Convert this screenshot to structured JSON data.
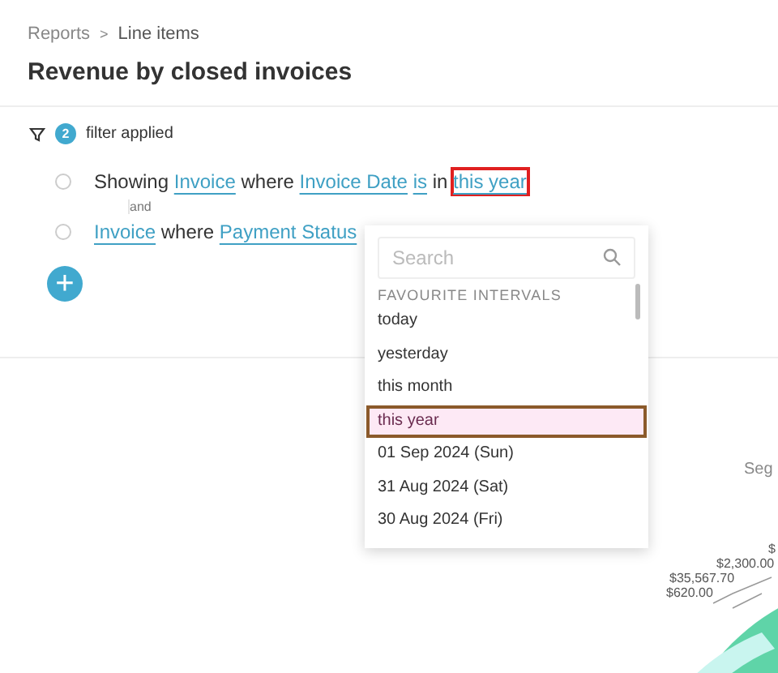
{
  "breadcrumb": [
    "Reports",
    "Line items"
  ],
  "breadcrumb_separator": ">",
  "title": "Revenue by closed invoices",
  "filter_summary": {
    "count": "2",
    "label": "filter applied"
  },
  "conditions": [
    {
      "selected": false,
      "parts": [
        {
          "kind": "text",
          "text": "Showing"
        },
        {
          "kind": "link",
          "text": "Invoice",
          "highlighted": false
        },
        {
          "kind": "text",
          "text": "where"
        },
        {
          "kind": "link",
          "text": "Invoice Date",
          "highlighted": false
        },
        {
          "kind": "link",
          "text": "is",
          "highlighted": false
        },
        {
          "kind": "text",
          "text": "in"
        },
        {
          "kind": "link",
          "text": "this year",
          "highlighted": true
        }
      ]
    },
    {
      "selected": false,
      "parts": [
        {
          "kind": "link",
          "text": "Invoice",
          "highlighted": false
        },
        {
          "kind": "text",
          "text": "where"
        },
        {
          "kind": "link",
          "text": "Payment Status",
          "highlighted": false
        }
      ]
    }
  ],
  "conjunction": "and",
  "add_button": "+",
  "dropdown": {
    "search_placeholder": "Search",
    "section": "FAVOURITE INTERVALS",
    "items": [
      {
        "label": "today",
        "selected": false
      },
      {
        "label": "yesterday",
        "selected": false
      },
      {
        "label": "this month",
        "selected": false
      },
      {
        "label": "this year",
        "selected": true
      },
      {
        "label": "01 Sep 2024 (Sun)",
        "selected": false
      },
      {
        "label": "31 Aug 2024 (Sat)",
        "selected": false
      },
      {
        "label": "30 Aug 2024 (Fri)",
        "selected": false
      }
    ]
  },
  "chart": {
    "legend_title": "Seg",
    "labels": [
      "$",
      "$2,300.00",
      "$35,567.70",
      "$620.00"
    ]
  }
}
